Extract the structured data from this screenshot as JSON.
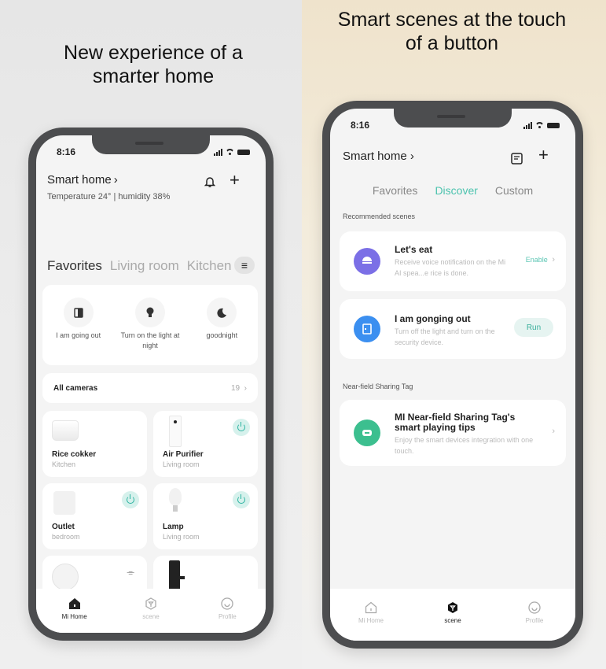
{
  "headlines": {
    "left": "New experience of a smarter home",
    "right": "Smart scenes at the touch of a button"
  },
  "status_bar": {
    "time": "8:16"
  },
  "home_screen": {
    "title": "Smart home",
    "title_chevron": "›",
    "climate": "Temperature  24°  |  humidity  38%",
    "tabs": [
      "Favorites",
      "Living room",
      "Kitchen"
    ],
    "active_tab": "Favorites",
    "scenes": [
      {
        "label": "I am going out",
        "icon": "door-icon"
      },
      {
        "label": "Turn on the light at night",
        "icon": "bulb-icon"
      },
      {
        "label": "goodnight",
        "icon": "moon-icon"
      }
    ],
    "cameras": {
      "label": "All cameras",
      "count": "19"
    },
    "devices": [
      {
        "name": "Rice cokker",
        "room": "Kitchen",
        "power": false
      },
      {
        "name": "Air Purifier",
        "room": "Living room",
        "power": true
      },
      {
        "name": "Outlet",
        "room": "bedroom",
        "power": true
      },
      {
        "name": "Lamp",
        "room": "Living room",
        "power": true
      },
      {
        "name": "",
        "room": "",
        "power": false
      },
      {
        "name": "",
        "room": "",
        "power": false
      }
    ],
    "tabbar": [
      {
        "label": "Mi Home",
        "active": true
      },
      {
        "label": "scene",
        "active": false
      },
      {
        "label": "Profile",
        "active": false
      }
    ]
  },
  "scene_screen": {
    "title": "Smart home",
    "tabs": [
      "Favorites",
      "Discover",
      "Custom"
    ],
    "active_tab": "Discover",
    "sections": {
      "recommended": "Recommended scenes",
      "nfc": "Near-field Sharing Tag"
    },
    "recommended": [
      {
        "name": "Let's eat",
        "desc": "Receive voice notification on the Mi AI spea...e rice is done.",
        "action": "Enable",
        "color": "#7b6fe6"
      },
      {
        "name": "I am gonging out",
        "desc": "Turn off the light and turn on the security device.",
        "action": "Run",
        "color": "#3b8ff0"
      }
    ],
    "nfc_card": {
      "name": "MI Near-field Sharing Tag's smart playing tips",
      "desc": "Enjoy the smart devices integration with one touch.",
      "color": "#3cbf8f"
    },
    "tabbar": [
      {
        "label": "Mi Home",
        "active": false
      },
      {
        "label": "scene",
        "active": true
      },
      {
        "label": "Profile",
        "active": false
      }
    ]
  },
  "colors": {
    "accent": "#4cc3ae",
    "frame": "#4c4d4f"
  }
}
